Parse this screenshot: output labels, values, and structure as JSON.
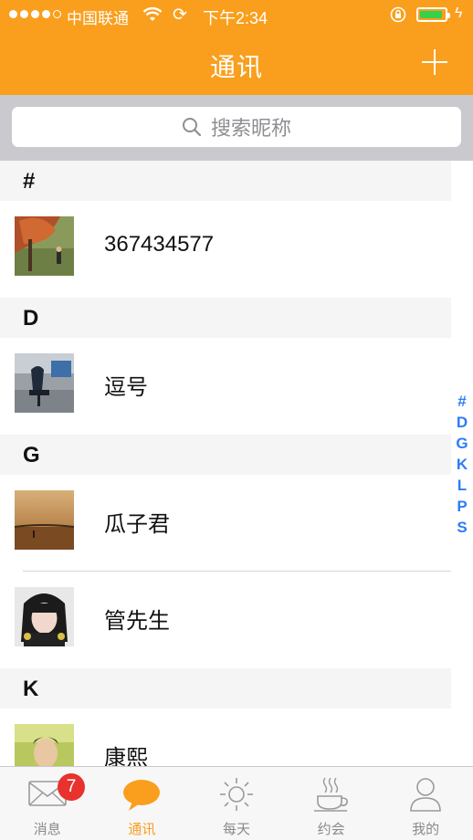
{
  "status_bar": {
    "carrier": "中国联通",
    "time": "下午2:34"
  },
  "nav": {
    "title": "通讯",
    "add_icon": "plus-icon"
  },
  "search": {
    "placeholder": "搜索昵称"
  },
  "sections": [
    {
      "letter": "#",
      "contacts": [
        "367434577"
      ]
    },
    {
      "letter": "D",
      "contacts": [
        "逗号"
      ]
    },
    {
      "letter": "G",
      "contacts": [
        "瓜子君",
        "管先生"
      ]
    },
    {
      "letter": "K",
      "contacts": [
        "康熙"
      ]
    }
  ],
  "index_letters": [
    "#",
    "D",
    "G",
    "K",
    "L",
    "P",
    "S"
  ],
  "tabs": [
    {
      "label": "消息",
      "icon": "envelope-icon",
      "badge": "7"
    },
    {
      "label": "通讯",
      "icon": "chat-bubble-icon",
      "active": true
    },
    {
      "label": "每天",
      "icon": "sun-icon"
    },
    {
      "label": "约会",
      "icon": "coffee-cup-icon"
    },
    {
      "label": "我的",
      "icon": "person-icon"
    }
  ],
  "colors": {
    "brand": "#f99f1d",
    "index_accent": "#2d7cf6",
    "badge": "#e8322e",
    "battery": "#35d149"
  }
}
